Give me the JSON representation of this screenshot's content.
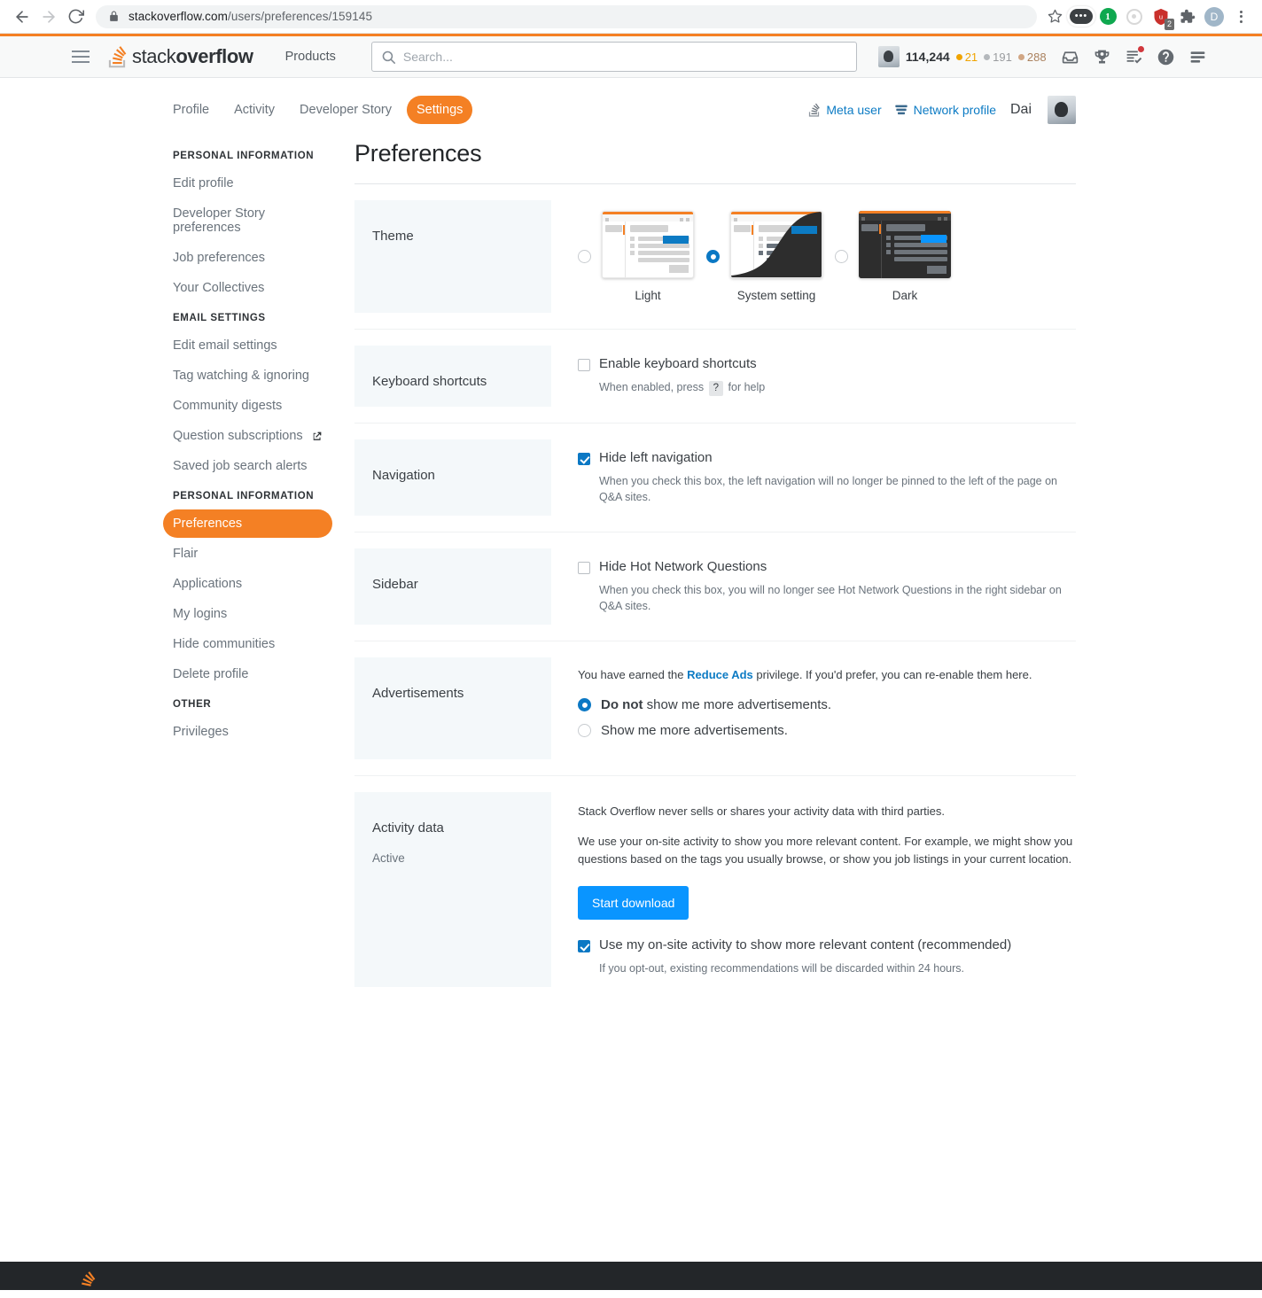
{
  "browser": {
    "url_host": "stackoverflow.com",
    "url_path": "/users/preferences/159145",
    "back_icon": "back-arrow-icon",
    "forward_icon": "forward-arrow-icon",
    "reload_icon": "reload-icon",
    "lock_icon": "lock-icon",
    "bookmark_icon": "star-icon",
    "extensions": [
      {
        "name": "dark-reader-extension",
        "label": "•••"
      },
      {
        "name": "onepassword-extension",
        "label": "1"
      },
      {
        "name": "privacy-badger-extension",
        "label": ""
      },
      {
        "name": "ublock-origin-extension",
        "label": "",
        "badge": "2"
      },
      {
        "name": "extensions-puzzle-icon",
        "label": ""
      }
    ],
    "profile_initial": "D",
    "menu_icon": "three-dot-menu-icon"
  },
  "topnav": {
    "hamburger": "hamburger-menu-icon",
    "logo_light": "stack",
    "logo_bold": "overflow",
    "products": "Products",
    "search_placeholder": "Search...",
    "search_value": "",
    "reputation": "114,244",
    "badges": {
      "gold": "21",
      "silver": "191",
      "bronze": "288"
    },
    "icons": [
      "inbox-icon",
      "trophy-icon",
      "review-queue-icon",
      "help-icon",
      "site-switcher-icon"
    ]
  },
  "user_tabs": [
    {
      "label": "Profile",
      "active": false
    },
    {
      "label": "Activity",
      "active": false
    },
    {
      "label": "Developer Story",
      "active": false
    },
    {
      "label": "Settings",
      "active": true
    }
  ],
  "user_links": {
    "meta_user": "Meta user",
    "network_profile": "Network profile",
    "display_name": "Dai"
  },
  "sidebar": {
    "groups": [
      {
        "title": "PERSONAL INFORMATION",
        "items": [
          {
            "label": "Edit profile",
            "active": false,
            "external": false
          },
          {
            "label": "Developer Story preferences",
            "active": false,
            "external": false
          },
          {
            "label": "Job preferences",
            "active": false,
            "external": false
          },
          {
            "label": "Your Collectives",
            "active": false,
            "external": false
          }
        ]
      },
      {
        "title": "EMAIL SETTINGS",
        "items": [
          {
            "label": "Edit email settings",
            "active": false,
            "external": false
          },
          {
            "label": "Tag watching & ignoring",
            "active": false,
            "external": false
          },
          {
            "label": "Community digests",
            "active": false,
            "external": false
          },
          {
            "label": "Question subscriptions",
            "active": false,
            "external": true
          },
          {
            "label": "Saved job search alerts",
            "active": false,
            "external": false
          }
        ]
      },
      {
        "title": "PERSONAL INFORMATION",
        "items": [
          {
            "label": "Preferences",
            "active": true,
            "external": false
          },
          {
            "label": "Flair",
            "active": false,
            "external": false
          },
          {
            "label": "Applications",
            "active": false,
            "external": false
          },
          {
            "label": "My logins",
            "active": false,
            "external": false
          },
          {
            "label": "Hide communities",
            "active": false,
            "external": false
          },
          {
            "label": "Delete profile",
            "active": false,
            "external": false
          }
        ]
      },
      {
        "title": "OTHER",
        "items": [
          {
            "label": "Privileges",
            "active": false,
            "external": false
          }
        ]
      }
    ]
  },
  "main": {
    "page_title": "Preferences",
    "theme": {
      "label": "Theme",
      "options": [
        {
          "caption": "Light",
          "selected": false
        },
        {
          "caption": "System setting",
          "selected": true
        },
        {
          "caption": "Dark",
          "selected": false
        }
      ]
    },
    "keyboard": {
      "label": "Keyboard shortcuts",
      "checkbox_label": "Enable keyboard shortcuts",
      "checked": false,
      "help_before": "When enabled, press",
      "help_key": "?",
      "help_after": "for help"
    },
    "navigation": {
      "label": "Navigation",
      "checkbox_label": "Hide left navigation",
      "checked": true,
      "help": "When you check this box, the left navigation will no longer be pinned to the left of the page on Q&A sites."
    },
    "sidebar_section": {
      "label": "Sidebar",
      "checkbox_label": "Hide Hot Network Questions",
      "checked": false,
      "help": "When you check this box, you will no longer see Hot Network Questions in the right sidebar on Q&A sites."
    },
    "advertisements": {
      "label": "Advertisements",
      "intro_before": "You have earned the",
      "intro_link": "Reduce Ads",
      "intro_after": "privilege. If you'd prefer, you can re-enable them here.",
      "options": [
        {
          "bold": "Do not",
          "rest": " show me more advertisements.",
          "selected": true
        },
        {
          "bold": "",
          "rest": "Show me more advertisements.",
          "selected": false
        }
      ]
    },
    "activity": {
      "label": "Activity data",
      "sub_label": "Active",
      "p1": "Stack Overflow never sells or shares your activity data with third parties.",
      "p2": "We use your on-site activity to show you more relevant content. For example, we might show you questions based on the tags you usually browse, or show you job listings in your current location.",
      "button": "Start download",
      "checkbox_label": "Use my on-site activity to show more relevant content (recommended)",
      "checked": true,
      "help": "If you opt-out, existing recommendations will be discarded within 24 hours."
    }
  },
  "colors": {
    "orange": "#f48024",
    "blue": "#0a95ff",
    "link_blue": "#0c7bc4",
    "footer_dark": "#232629",
    "label_bg": "#f4f8fa"
  }
}
